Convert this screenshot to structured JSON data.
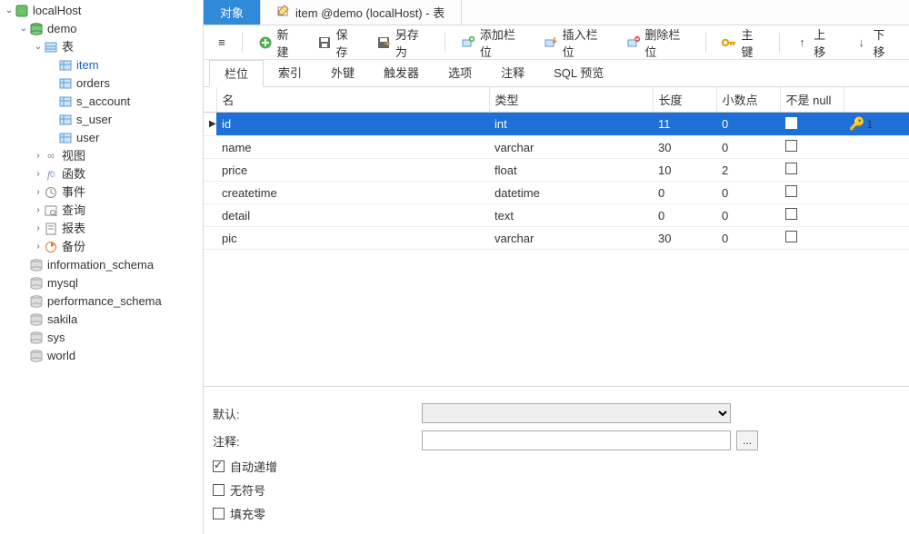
{
  "tree": {
    "conn": "localHost",
    "db_open": "demo",
    "tables_node": "表",
    "tables": [
      "item",
      "orders",
      "s_account",
      "s_user",
      "user"
    ],
    "other_nodes": [
      {
        "icon": "view",
        "label": "视图"
      },
      {
        "icon": "fn",
        "label": "函数"
      },
      {
        "icon": "evt",
        "label": "事件"
      },
      {
        "icon": "qry",
        "label": "查询"
      },
      {
        "icon": "rpt",
        "label": "报表"
      },
      {
        "icon": "bkp",
        "label": "备份"
      }
    ],
    "other_dbs": [
      "information_schema",
      "mysql",
      "performance_schema",
      "sakila",
      "sys",
      "world"
    ]
  },
  "doc_tabs": {
    "object": "对象",
    "editor": "item @demo (localHost) - 表"
  },
  "toolbar": {
    "new": "新建",
    "save": "保存",
    "saveas": "另存为",
    "add_field": "添加栏位",
    "insert_field": "插入栏位",
    "delete_field": "删除栏位",
    "primary_key": "主键",
    "move_up": "上移",
    "move_down": "下移"
  },
  "sub_tabs": [
    "栏位",
    "索引",
    "外键",
    "触发器",
    "选项",
    "注释",
    "SQL 预览"
  ],
  "columns_header": {
    "name": "名",
    "type": "类型",
    "len": "长度",
    "dec": "小数点",
    "notnull": "不是 null"
  },
  "fields": [
    {
      "name": "id",
      "type": "int",
      "len": "11",
      "dec": "0",
      "notnull": true,
      "pk": "1",
      "selected": true
    },
    {
      "name": "name",
      "type": "varchar",
      "len": "30",
      "dec": "0",
      "notnull": false
    },
    {
      "name": "price",
      "type": "float",
      "len": "10",
      "dec": "2",
      "notnull": false
    },
    {
      "name": "createtime",
      "type": "datetime",
      "len": "0",
      "dec": "0",
      "notnull": false
    },
    {
      "name": "detail",
      "type": "text",
      "len": "0",
      "dec": "0",
      "notnull": false
    },
    {
      "name": "pic",
      "type": "varchar",
      "len": "30",
      "dec": "0",
      "notnull": false
    }
  ],
  "props": {
    "default": "默认:",
    "comment": "注释:",
    "auto_inc": "自动递增",
    "unsigned": "无符号",
    "zerofill": "填充零",
    "auto_inc_checked": true
  }
}
